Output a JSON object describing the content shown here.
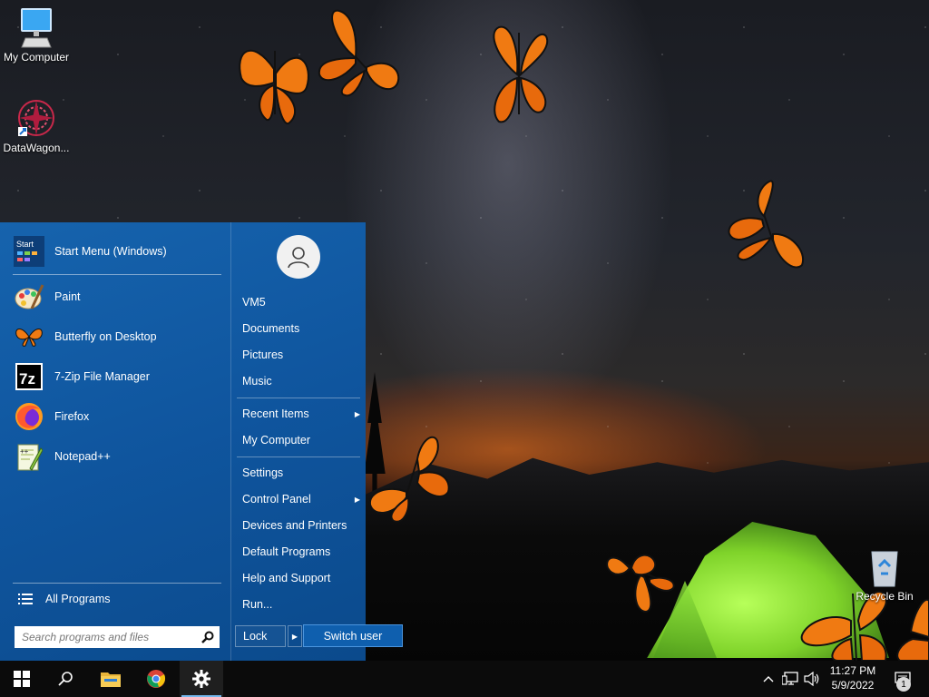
{
  "desktop": {
    "icons": [
      {
        "label": "My Computer",
        "icon": "monitor-icon"
      },
      {
        "label": "DataWagon...",
        "icon": "datawagon-icon"
      },
      {
        "label": "Recycle Bin",
        "icon": "recycle-bin-icon"
      }
    ]
  },
  "start_menu": {
    "pinned": [
      {
        "label": "Start Menu (Windows)",
        "icon": "start-menu-icon"
      },
      {
        "label": "Paint",
        "icon": "paint-icon"
      },
      {
        "label": "Butterfly on Desktop",
        "icon": "butterfly-icon"
      },
      {
        "label": "7-Zip File Manager",
        "icon": "7zip-icon"
      },
      {
        "label": "Firefox",
        "icon": "firefox-icon"
      },
      {
        "label": "Notepad++",
        "icon": "notepadpp-icon"
      }
    ],
    "all_programs": "All Programs",
    "search_placeholder": "Search programs and files",
    "right": {
      "user": "VM5",
      "items1": [
        "Documents",
        "Pictures",
        "Music"
      ],
      "items2": [
        "Recent Items",
        "My Computer"
      ],
      "items3": [
        "Settings",
        "Control Panel",
        "Devices and Printers",
        "Default Programs",
        "Help and Support",
        "Run..."
      ]
    },
    "lock": "Lock",
    "switch_user": "Switch user"
  },
  "taskbar": {
    "time": "11:27 PM",
    "date": "5/9/2022",
    "notification_count": "1"
  },
  "colors": {
    "start_menu_bg": "#0f559e",
    "accent": "#76b9ed",
    "taskbar_bg": "#0b0b0b",
    "tent": "#7fd32a",
    "butterfly": "#f07a12"
  }
}
